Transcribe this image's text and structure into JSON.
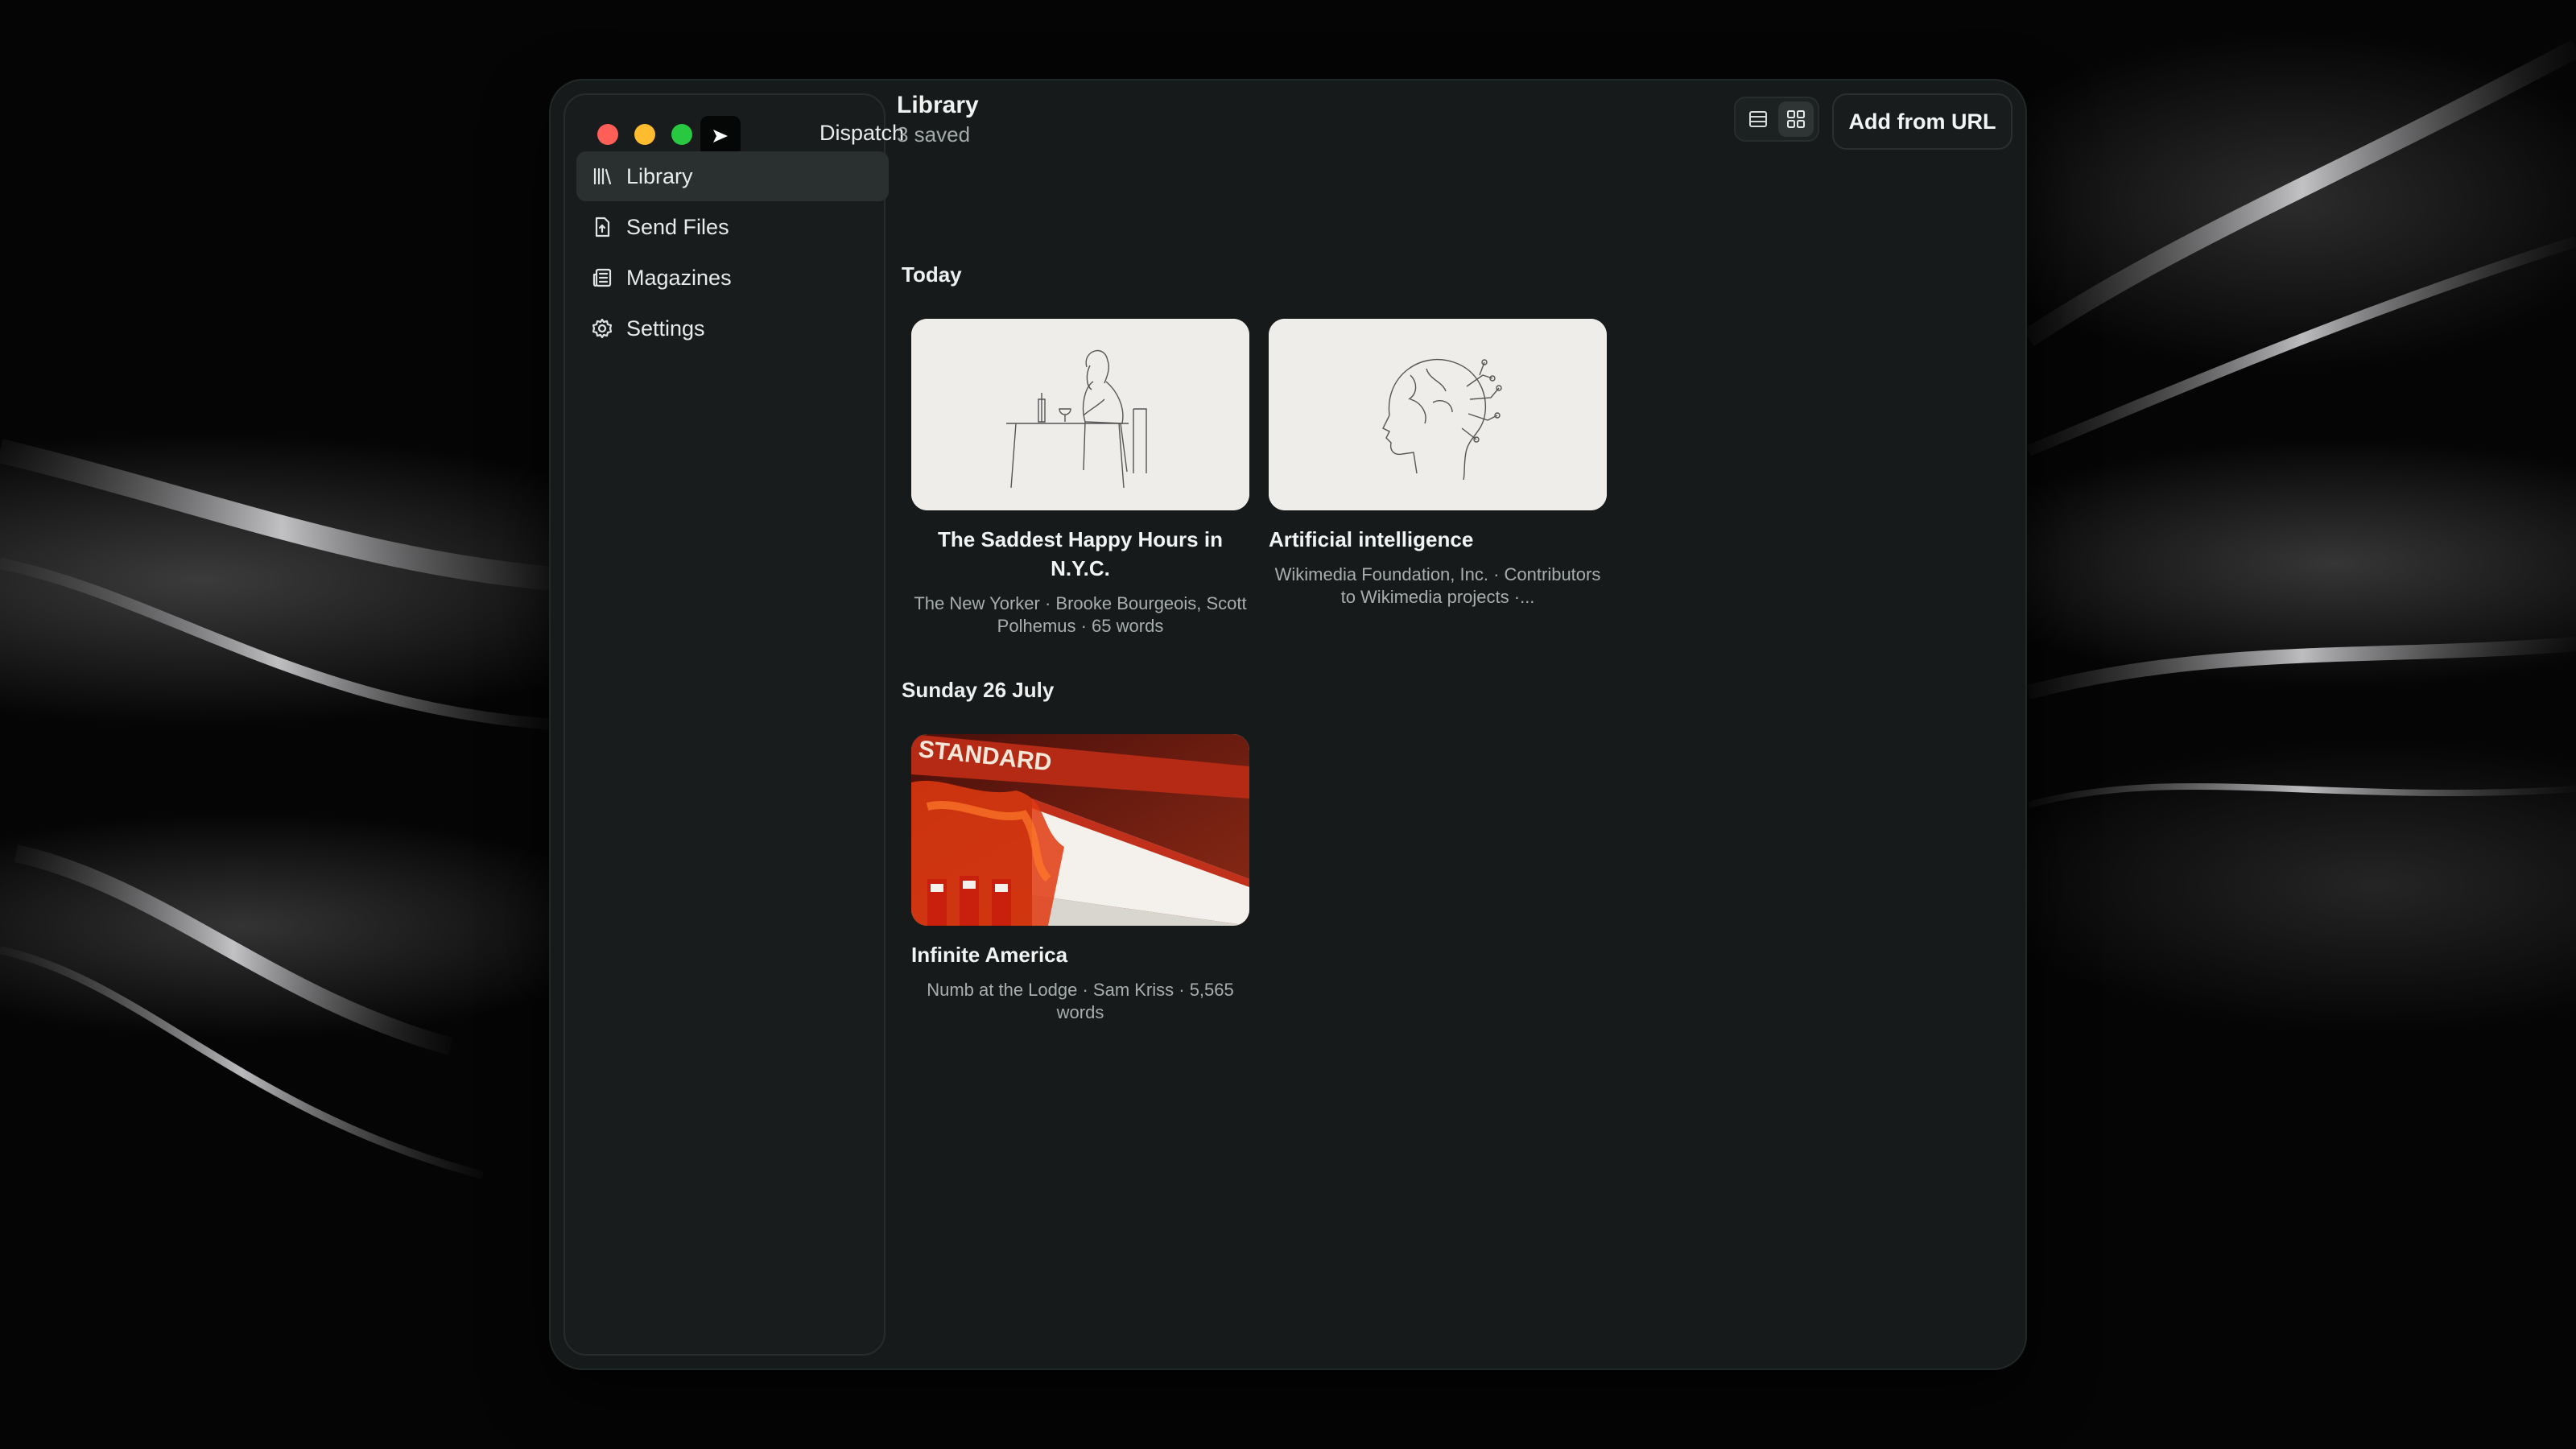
{
  "app": {
    "name": "Dispatch"
  },
  "sidebar": {
    "items": [
      {
        "label": "Library",
        "icon": "library-icon",
        "active": true
      },
      {
        "label": "Send Files",
        "icon": "file-upload-icon",
        "active": false
      },
      {
        "label": "Magazines",
        "icon": "newspaper-icon",
        "active": false
      },
      {
        "label": "Settings",
        "icon": "gear-icon",
        "active": false
      }
    ]
  },
  "header": {
    "title": "Library",
    "subtitle": "3 saved",
    "add_button": "Add from URL",
    "view_mode": "grid"
  },
  "sections": [
    {
      "label": "Today",
      "items": [
        {
          "title": "The Saddest Happy Hours in N.Y.C.",
          "meta": "The New Yorker · Brooke Bourgeois, Scott Polhemus · 65 words",
          "thumb": "sketch-woman-at-table"
        },
        {
          "title": "Artificial intelligence",
          "meta": "Wikimedia Foundation, Inc. · Contributors to Wikimedia projects ·...",
          "thumb": "sketch-head-circuit"
        }
      ]
    },
    {
      "label": "Sunday 26 July",
      "items": [
        {
          "title": "Infinite America",
          "meta": "Numb at the Lodge · Sam Kriss · 5,565 words",
          "thumb": "gas-station-painting",
          "thumb_text": "STANDARD"
        }
      ]
    }
  ],
  "colors": {
    "window_bg": "#161a1a",
    "sidebar_active": "#2a302f",
    "close": "#ff5f57",
    "minimize": "#febc2e",
    "zoom": "#28c840"
  }
}
